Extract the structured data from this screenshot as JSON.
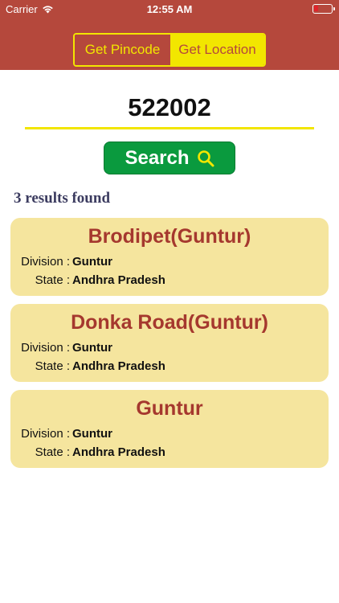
{
  "status_bar": {
    "carrier": "Carrier",
    "time": "12:55 AM"
  },
  "tabs": {
    "get_pincode": "Get Pincode",
    "get_location": "Get Location"
  },
  "search": {
    "pincode_value": "522002",
    "button_label": "Search"
  },
  "results_summary": "3 results found",
  "results": [
    {
      "name": "Brodipet(Guntur)",
      "division_label": "Division :",
      "division": "Guntur",
      "state_label": "State :",
      "state": "Andhra Pradesh"
    },
    {
      "name": "Donka Road(Guntur)",
      "division_label": "Division :",
      "division": "Guntur",
      "state_label": "State :",
      "state": "Andhra Pradesh"
    },
    {
      "name": "Guntur",
      "division_label": "Division :",
      "division": "Guntur",
      "state_label": "State :",
      "state": "Andhra Pradesh"
    }
  ],
  "icons": {
    "wifi": "wifi-icon",
    "battery": "battery-icon",
    "search": "search-icon"
  },
  "colors": {
    "header": "#b5483c",
    "accent": "#f2e600",
    "button": "#0a9a3e",
    "card": "#f5e59e",
    "card_title": "#a5382e"
  }
}
